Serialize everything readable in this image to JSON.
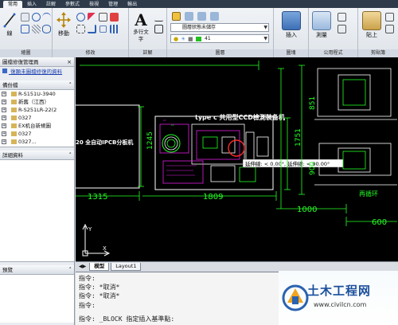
{
  "ribbon": {
    "tabs": [
      "常用",
      "插入",
      "註解",
      "參數式",
      "檢視",
      "管理",
      "輸出"
    ],
    "panels": {
      "draw": {
        "title": "繪圖",
        "line_label": "線"
      },
      "modify": {
        "title": "修改",
        "move_label": "移動"
      },
      "annotation": {
        "title": "註解",
        "text_label": "多行文字",
        "text_icon": "A"
      },
      "layers": {
        "title": "圖層",
        "layer_combo": "圖層狀態未儲存",
        "layer_value": "41"
      },
      "block": {
        "title": "圖塊",
        "insert_label": "插入"
      },
      "groups": {
        "title": "公用程式",
        "group_label": "測量"
      },
      "clipboard": {
        "title": "剪貼簿",
        "paste_label": "貼上"
      }
    }
  },
  "palette": {
    "title": "圖檔修復管理員",
    "link": "復顯未圖檔修復的資料",
    "backup_header": "備份檔",
    "tree_items": [
      "R-S151U-3940",
      "新舊（江西）",
      "R-S251LR-22(2",
      "0327",
      "EX机台新規圖",
      "0327",
      "0327..."
    ],
    "details_header": "詳細資料",
    "preview_header": "預覽"
  },
  "drawing": {
    "title": "type c   共用型CCD檢測裝备机",
    "left_label": "20 全自动IPCB分板机",
    "right_label": "再循环",
    "tooltip": "延伸線: < 0.00°, 延伸線: < 90.00°",
    "dims": {
      "d1315": "1315",
      "d1809": "1809",
      "d1000": "1000",
      "d1245": "1245",
      "d1751": "1751",
      "d851": "851",
      "d600": "600",
      "d900": "900"
    },
    "axis_x": "X",
    "axis_y": "Y",
    "colors": {
      "bg": "#000000",
      "dim": "#25ff25",
      "outline": "#ffffff",
      "part": "#e020e0",
      "accent": "#ff2a2a"
    }
  },
  "layout_tabs": [
    "模型",
    "Layout1"
  ],
  "command": {
    "lines": [
      "指令:",
      "指令: *取消*",
      "指令: *取消*",
      "指令:",
      "指令: _BLOCK 指定插入基準點:"
    ]
  },
  "watermark": {
    "title": "土木工程网",
    "url": "www.civilcn.com"
  }
}
